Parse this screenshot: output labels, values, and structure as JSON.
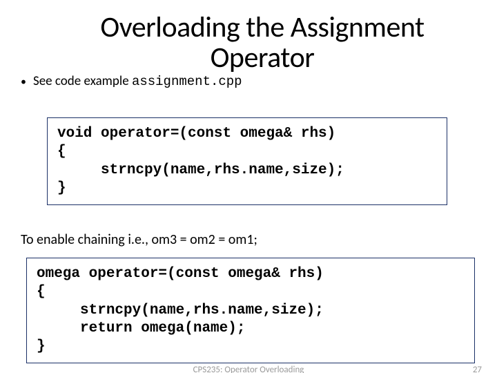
{
  "title_line1": "Overloading the Assignment",
  "title_line2": "Operator",
  "bullet": {
    "prefix": "See code example ",
    "filename": "assignment.cpp"
  },
  "code1": "void operator=(const omega& rhs)\n{\n     strncpy(name,rhs.name,size);\n}",
  "chain_text": "To enable chaining i.e., om3 = om2 = om1;",
  "code2": "omega operator=(const omega& rhs)\n{\n     strncpy(name,rhs.name,size);\n     return omega(name);\n}",
  "footer": {
    "center": "CPS235: Operator Overloading",
    "page": "27"
  }
}
